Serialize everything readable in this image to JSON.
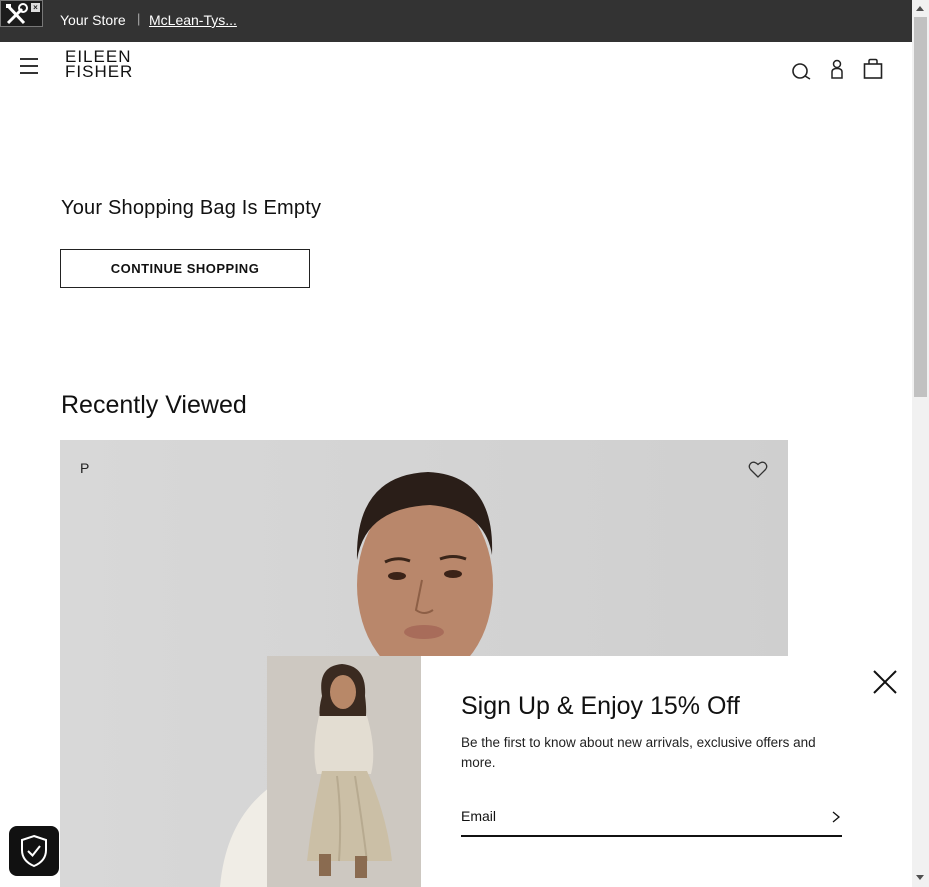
{
  "store_bar": {
    "label": "Your Store",
    "separator": "|",
    "store_link": "McLean-Tys..."
  },
  "header": {
    "logo_line1": "EILEEN",
    "logo_line2": "FISHER"
  },
  "main": {
    "empty_title": "Your Shopping Bag Is Empty",
    "continue_label": "CONTINUE SHOPPING",
    "recent_title": "Recently Viewed",
    "product_badge": "P"
  },
  "popup": {
    "title": "Sign Up & Enjoy 15% Off",
    "subtitle": "Be the first to know about new arrivals, exclusive offers and more.",
    "email_placeholder": "Email"
  },
  "colors": {
    "top_bar": "#333333",
    "product_bg": "#d3d3d3",
    "text": "#111111"
  },
  "icons": [
    "tools-icon",
    "menu-icon",
    "search-icon",
    "account-icon",
    "bag-icon",
    "heart-icon",
    "close-icon",
    "chevron-right-icon",
    "shield-check-icon"
  ]
}
